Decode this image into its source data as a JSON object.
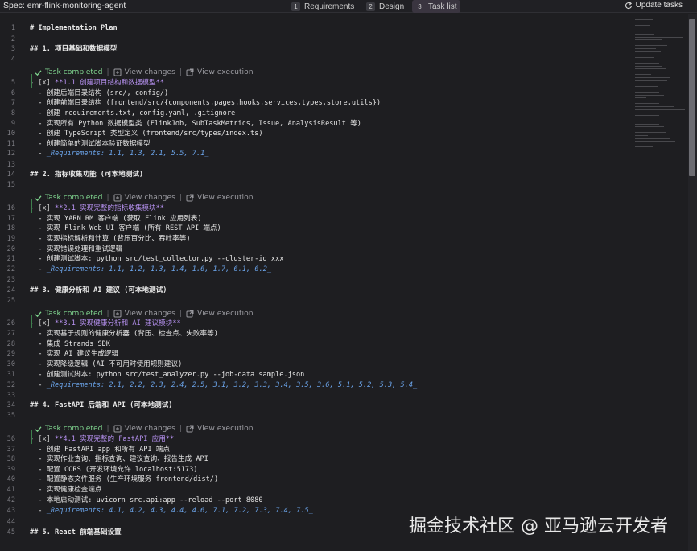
{
  "header": {
    "spec_title": "Spec: emr-flink-monitoring-agent",
    "tabs": [
      {
        "num": "1",
        "label": "Requirements"
      },
      {
        "num": "2",
        "label": "Design"
      },
      {
        "num": "3",
        "label": "Task list"
      }
    ],
    "update_label": "Update tasks"
  },
  "codelens": {
    "completed": "Task completed",
    "view_changes": "View changes",
    "view_execution": "View execution",
    "separator": "|"
  },
  "lines": [
    {
      "n": "1",
      "text": "# Implementation Plan"
    },
    {
      "n": "2",
      "text": ""
    },
    {
      "n": "3",
      "text": "## 1. 项目基础和数据模型"
    },
    {
      "n": "4",
      "text": ""
    },
    {
      "n": "5",
      "check": "- [x] ",
      "bold": "**1.1 创建项目结构和数据模型**"
    },
    {
      "n": "6",
      "text": "  - 创建后端目录结构 (src/, config/)"
    },
    {
      "n": "7",
      "text": "  - 创建前端目录结构 (frontend/src/{components,pages,hooks,services,types,store,utils})"
    },
    {
      "n": "8",
      "text": "  - 创建 requirements.txt, config.yaml, .gitignore"
    },
    {
      "n": "9",
      "text": "  - 实现所有 Python 数据模型类 (FlinkJob, SubTaskMetrics, Issue, AnalysisResult 等)"
    },
    {
      "n": "10",
      "text": "  - 创建 TypeScript 类型定义 (frontend/src/types/index.ts)"
    },
    {
      "n": "11",
      "text": "  - 创建简单的测试脚本验证数据模型"
    },
    {
      "n": "12",
      "prefix": "  - ",
      "req": "_Requirements: 1.1, 1.3, 2.1, 5.5, 7.1_"
    },
    {
      "n": "13",
      "text": ""
    },
    {
      "n": "14",
      "text": "## 2. 指标收集功能 (可本地测试)"
    },
    {
      "n": "15",
      "text": ""
    },
    {
      "n": "16",
      "check": "- [x] ",
      "bold": "**2.1 实现完整的指标收集模块**"
    },
    {
      "n": "17",
      "text": "  - 实现 YARN RM 客户端 (获取 Flink 应用列表)"
    },
    {
      "n": "18",
      "text": "  - 实现 Flink Web UI 客户端 (所有 REST API 端点)"
    },
    {
      "n": "19",
      "text": "  - 实现指标解析和计算 (背压百分比、吞吐率等)"
    },
    {
      "n": "20",
      "text": "  - 实现错误处理和重试逻辑"
    },
    {
      "n": "21",
      "text": "  - 创建测试脚本: python src/test_collector.py --cluster-id xxx"
    },
    {
      "n": "22",
      "prefix": "  - ",
      "req": "_Requirements: 1.1, 1.2, 1.3, 1.4, 1.6, 1.7, 6.1, 6.2_"
    },
    {
      "n": "23",
      "text": ""
    },
    {
      "n": "24",
      "text": "## 3. 健康分析和 AI 建议 (可本地测试)"
    },
    {
      "n": "25",
      "text": ""
    },
    {
      "n": "26",
      "check": "- [x] ",
      "bold": "**3.1 实现健康分析和 AI 建议模块**"
    },
    {
      "n": "27",
      "text": "  - 实现基于规则的健康分析器 (背压、检查点、失败率等)"
    },
    {
      "n": "28",
      "text": "  - 集成 Strands SDK"
    },
    {
      "n": "29",
      "text": "  - 实现 AI 建议生成逻辑"
    },
    {
      "n": "30",
      "text": "  - 实现降级逻辑 (AI 不可用时使用规则建议)"
    },
    {
      "n": "31",
      "text": "  - 创建测试脚本: python src/test_analyzer.py --job-data sample.json"
    },
    {
      "n": "32",
      "prefix": "  - ",
      "req": "_Requirements: 2.1, 2.2, 2.3, 2.4, 2.5, 3.1, 3.2, 3.3, 3.4, 3.5, 3.6, 5.1, 5.2, 5.3, 5.4_"
    },
    {
      "n": "33",
      "text": ""
    },
    {
      "n": "34",
      "text": "## 4. FastAPI 后端和 API (可本地测试)"
    },
    {
      "n": "35",
      "text": ""
    },
    {
      "n": "36",
      "check": "- [x] ",
      "bold": "**4.1 实现完整的 FastAPI 应用**"
    },
    {
      "n": "37",
      "text": "  - 创建 FastAPI app 和所有 API 端点"
    },
    {
      "n": "38",
      "text": "  - 实现作业查询、指标查询、建议查询、报告生成 API"
    },
    {
      "n": "39",
      "text": "  - 配置 CORS (开发环境允许 localhost:5173)"
    },
    {
      "n": "40",
      "text": "  - 配置静态文件服务 (生产环境服务 frontend/dist/)"
    },
    {
      "n": "41",
      "text": "  - 实现健康检查端点"
    },
    {
      "n": "42",
      "text": "  - 本地启动测试: uvicorn src.api:app --reload --port 8080"
    },
    {
      "n": "43",
      "prefix": "  - ",
      "req": "_Requirements: 4.1, 4.2, 4.3, 4.4, 4.6, 7.1, 7.2, 7.3, 7.4, 7.5_"
    },
    {
      "n": "44",
      "text": ""
    },
    {
      "n": "45",
      "text": "## 5. React 前端基础设置"
    }
  ],
  "watermark": "掘金技术社区 @ 亚马逊云开发者",
  "colors": {
    "background": "#1e1e21",
    "completed_green": "#7fd38e",
    "bold_purple": "#b691f0",
    "requirements_blue": "#6ba4ea"
  }
}
